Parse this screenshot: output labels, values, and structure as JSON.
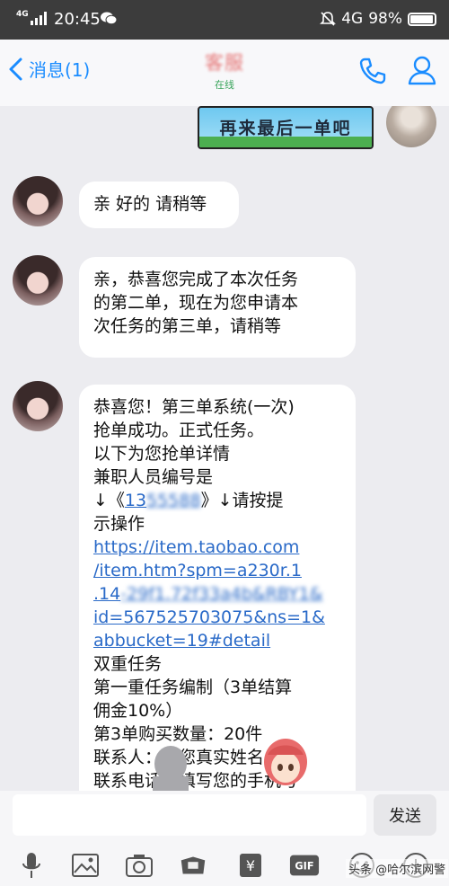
{
  "status_bar": {
    "network_small": "4G",
    "time": "20:45",
    "network": "4G",
    "battery": "98%"
  },
  "header": {
    "back_label": "消息(1)",
    "contact_name": "客服",
    "status": "在线"
  },
  "messages": [
    {
      "from": "me",
      "type": "sticker",
      "text": "再来最后一单吧"
    },
    {
      "from": "contact",
      "type": "text",
      "lines": [
        "亲 好的 请稍等"
      ]
    },
    {
      "from": "contact",
      "type": "text",
      "lines": [
        "亲，恭喜您完成了本次任务",
        "的第二单，现在为您申请本",
        "次任务的第三单，请稍等"
      ]
    },
    {
      "from": "contact",
      "type": "rich",
      "line1": "恭喜您！第三单系统(一次)",
      "line2": "抢单成功。正式任务。",
      "line3": "以下为您抢单详情",
      "line4": "兼职人员编号是",
      "arrow_open": "↓《",
      "employee_id": "13",
      "arrow_close": "》↓请按提",
      "line6": "示操作",
      "link_lines": [
        "https://item.taobao.com",
        "/item.htm?spm=a230r.1",
        ".14",
        "id=567525703075&ns=1&",
        "abbucket=19#detail"
      ],
      "line12": "双重任务",
      "line13": "第一重任务编制（3单结算",
      "line14": "佣金10%）",
      "line15": "第3单购买数量：20件",
      "line16": "联系人：填您真实姓名",
      "line17": "联系电话：填写您的手机号"
    }
  ],
  "input": {
    "placeholder": "",
    "send_label": "发送"
  },
  "toolbar": [
    "mic-icon",
    "image-icon",
    "camera-icon",
    "hongbao-icon",
    "yuan-icon",
    "gif-icon",
    "emoji-icon",
    "plus-icon"
  ],
  "watermark": "头条 @哈尔滨网警"
}
